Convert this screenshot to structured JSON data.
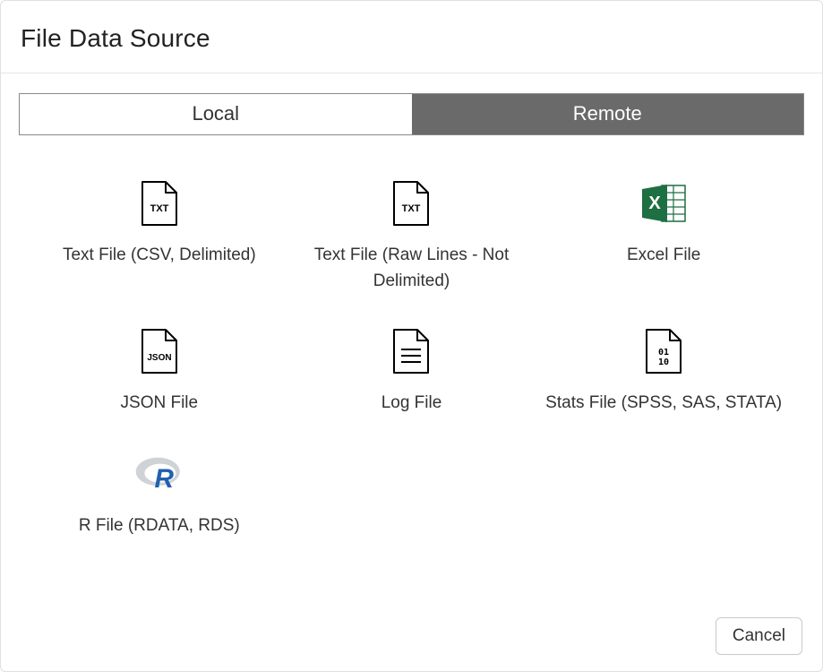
{
  "dialog": {
    "title": "File Data Source"
  },
  "tabs": {
    "local": "Local",
    "remote": "Remote",
    "active": "remote"
  },
  "options": [
    {
      "id": "text-csv",
      "icon": "txt-file-icon",
      "label": "Text File (CSV, Delimited)"
    },
    {
      "id": "text-raw",
      "icon": "txt-file-icon",
      "label": "Text File (Raw Lines - Not Delimited)"
    },
    {
      "id": "excel",
      "icon": "excel-icon",
      "label": "Excel File"
    },
    {
      "id": "json",
      "icon": "json-file-icon",
      "label": "JSON File"
    },
    {
      "id": "log",
      "icon": "log-file-icon",
      "label": "Log File"
    },
    {
      "id": "stats",
      "icon": "stats-file-icon",
      "label": "Stats File (SPSS, SAS, STATA)"
    },
    {
      "id": "r",
      "icon": "r-logo-icon",
      "label": "R File (RDATA, RDS)"
    }
  ],
  "footer": {
    "cancel": "Cancel"
  }
}
